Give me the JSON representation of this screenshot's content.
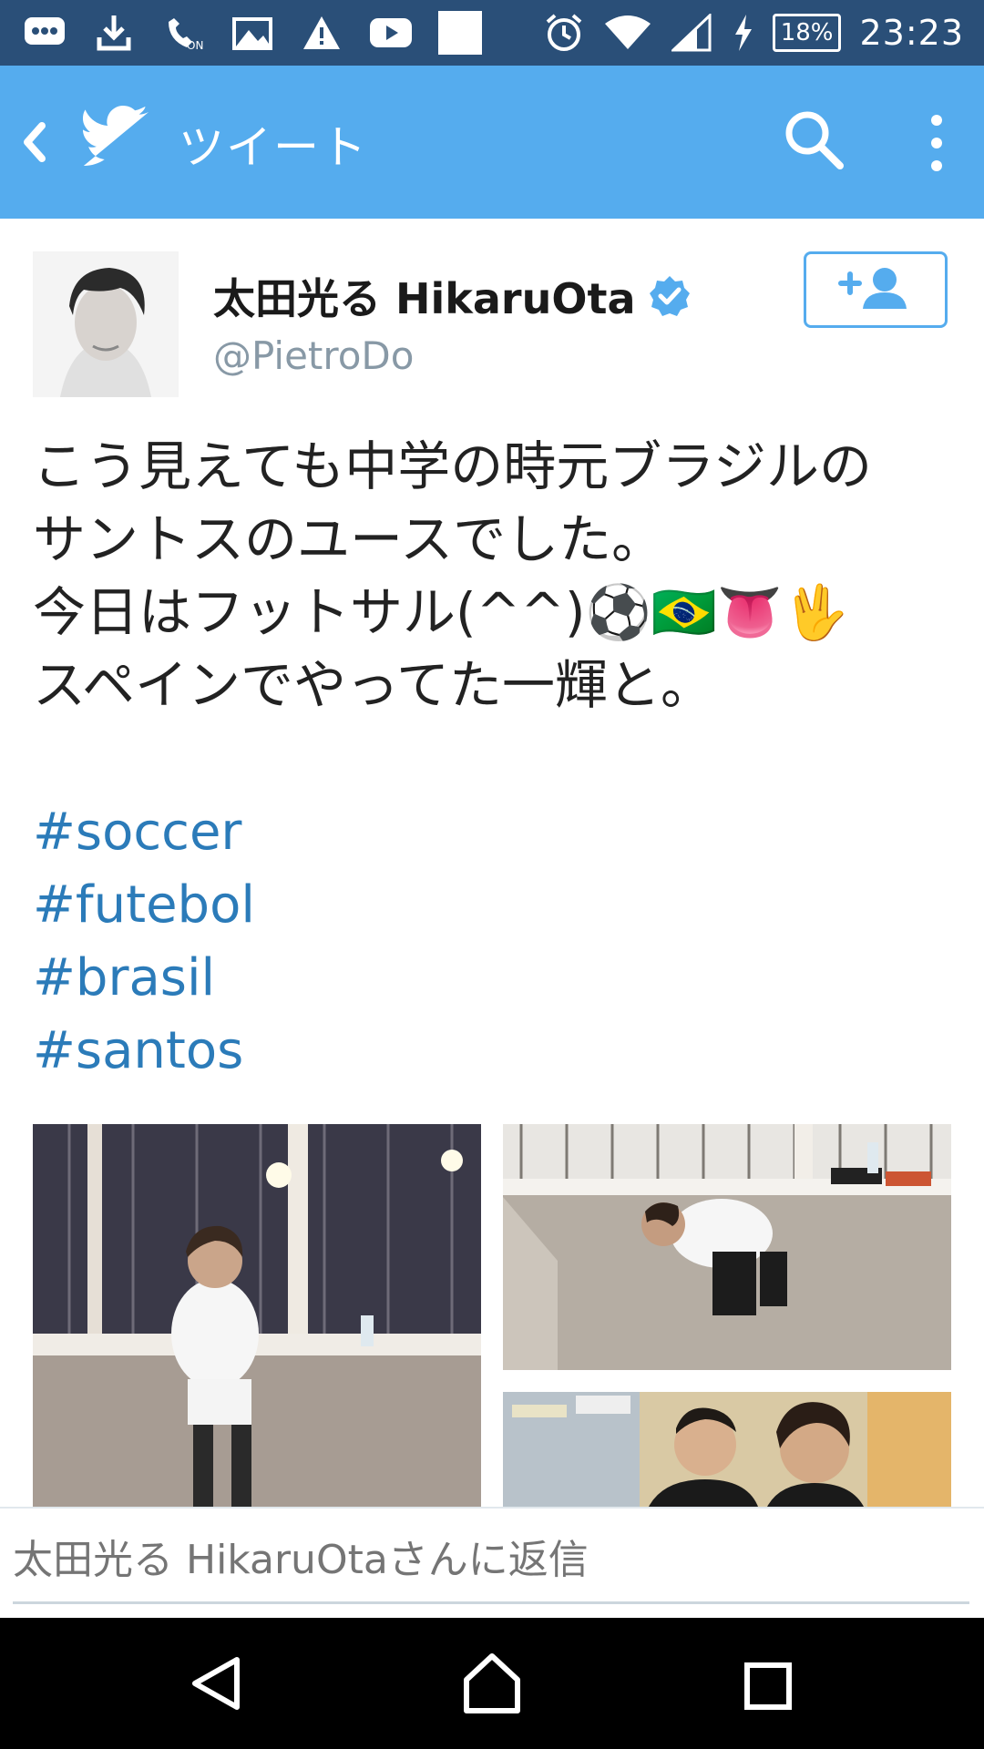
{
  "status_bar": {
    "time": "23:23",
    "battery": "18%",
    "left_icons": [
      "message-icon",
      "download-icon",
      "volte-icon",
      "image-icon",
      "warning-icon",
      "youtube-icon",
      "white-square-icon"
    ],
    "right_icons": [
      "alarm-icon",
      "wifi-icon",
      "signal-icon",
      "charging-icon"
    ]
  },
  "app_bar": {
    "title": "ツイート",
    "background": "#55acee",
    "icons": [
      "back-arrow-icon",
      "twitter-bird-icon",
      "search-icon",
      "more-vert-icon"
    ]
  },
  "tweet": {
    "display_name": "太田光る HikaruOta",
    "handle": "@PietroDo",
    "verified": true,
    "follow_icon": "add-user-icon",
    "text_lines": [
      "こう見えても中学の時元ブラジルの",
      "サントスのユースでした。",
      "今日はフットサル(^^)⚽🇧🇷👅🖖",
      "スペインでやってた一輝と。"
    ],
    "hashtags": [
      "#soccer",
      "#futebol",
      "#brasil",
      "#santos"
    ],
    "photos": [
      "photo-1",
      "photo-2",
      "photo-3"
    ]
  },
  "reply": {
    "placeholder": "太田光る HikaruOtaさんに返信"
  },
  "nav_bar": {
    "icons": [
      "back-triangle-icon",
      "home-icon",
      "recents-icon"
    ]
  }
}
